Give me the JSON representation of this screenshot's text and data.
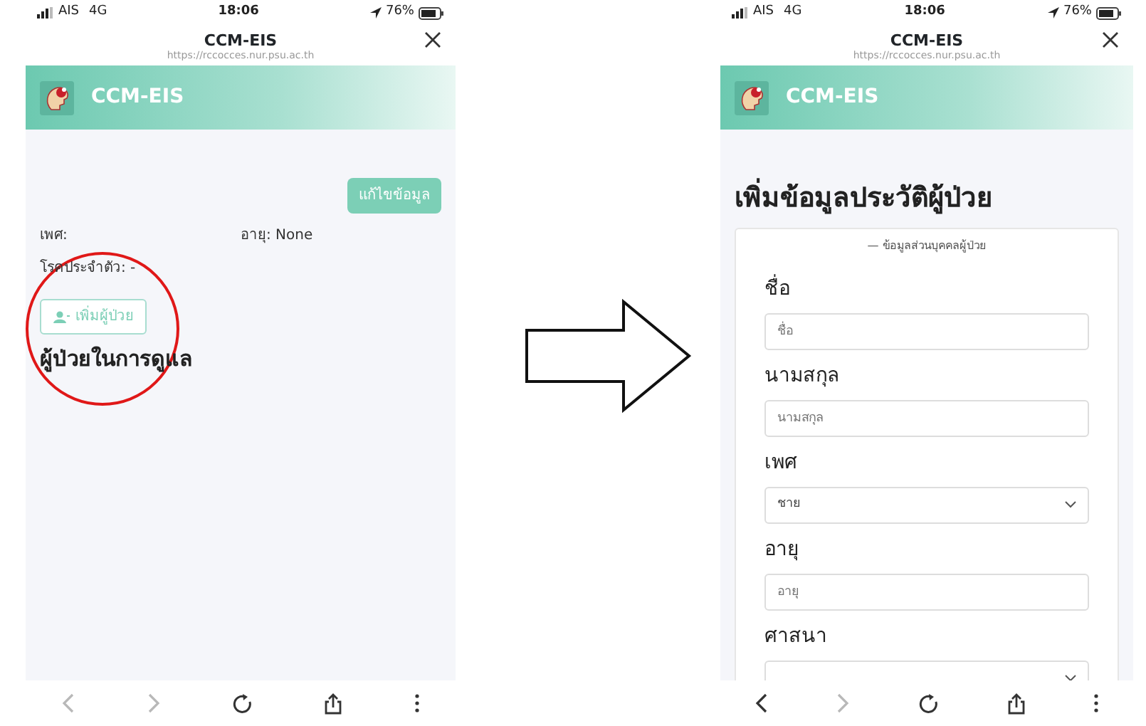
{
  "screens": [
    {
      "kind": "profile",
      "status_bar": {
        "carrier": "AIS",
        "network": "4G",
        "time": "18:06",
        "battery": "76%"
      },
      "browser": {
        "title": "CCM-EIS",
        "url": "https://rccocces.nur.psu.ac.th"
      },
      "app_bar": {
        "title": "CCM-EIS"
      },
      "edit_button": "แก้ไขข้อมูล",
      "info": [
        {
          "label": "เพศ:"
        },
        {
          "label": "อายุ: None"
        },
        {
          "label": "โรคประจำตัว: -"
        }
      ],
      "add_button": "เพิ่มผู้ป่วย",
      "heading": "ผู้ป่วยในการดูแล",
      "highlighted": true,
      "toolbar": [
        {
          "kind": "back",
          "disabled": true
        },
        {
          "kind": "forward",
          "disabled": true
        },
        {
          "kind": "reload",
          "disabled": false
        },
        {
          "kind": "share",
          "disabled": false
        },
        {
          "kind": "more",
          "disabled": false
        }
      ]
    },
    {
      "kind": "form",
      "status_bar": {
        "carrier": "AIS",
        "network": "4G",
        "time": "18:06",
        "battery": "76%"
      },
      "browser": {
        "title": "CCM-EIS",
        "url": "https://rccocces.nur.psu.ac.th"
      },
      "app_bar": {
        "title": "CCM-EIS"
      },
      "heading": "เพิ่มข้อมูลประวัติผู้ป่วย",
      "section": "— ข้อมูลส่วนบุคคลผู้ป่วย",
      "fields": [
        {
          "label": "ชื่อ",
          "kind": "text",
          "placeholder": "ชื่อ"
        },
        {
          "label": "นามสกุล",
          "kind": "text",
          "placeholder": "นามสกุล"
        },
        {
          "label": "เพศ",
          "kind": "select",
          "value": "ชาย"
        },
        {
          "label": "อายุ",
          "kind": "text",
          "placeholder": "อายุ"
        },
        {
          "label": "ศาสนา",
          "kind": "select"
        }
      ],
      "toolbar": [
        {
          "kind": "back",
          "disabled": false
        },
        {
          "kind": "forward",
          "disabled": true
        },
        {
          "kind": "reload",
          "disabled": false
        },
        {
          "kind": "share",
          "disabled": false
        },
        {
          "kind": "more",
          "disabled": false
        }
      ]
    }
  ]
}
